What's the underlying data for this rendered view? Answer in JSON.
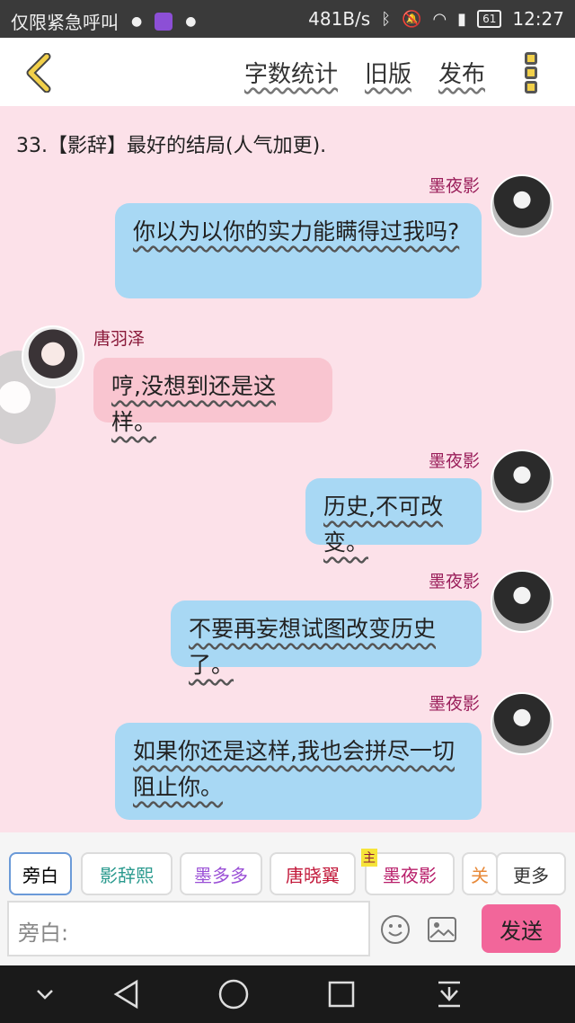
{
  "status_bar": {
    "left_text": "仅限紧急呼叫",
    "speed": "481B/s",
    "battery": "61",
    "time": "12:27"
  },
  "header": {
    "nav": [
      "字数统计",
      "旧版",
      "发布"
    ]
  },
  "chapter": {
    "title": "33.【影辞】最好的结局(人气加更)."
  },
  "messages": [
    {
      "speaker": "墨夜影",
      "text": "你以为以你的实力能瞒得过我吗?"
    },
    {
      "speaker": "唐羽泽",
      "text": "哼,没想到还是这样。"
    },
    {
      "speaker": "墨夜影",
      "text": "历史,不可改变。"
    },
    {
      "speaker": "墨夜影",
      "text": "不要再妄想试图改变历史了。"
    },
    {
      "speaker": "墨夜影",
      "text": "如果你还是这样,我也会拼尽一切阻止你。"
    }
  ],
  "roles": [
    "旁白",
    "影辞熙",
    "墨多多",
    "唐晓翼",
    "墨夜影",
    "关",
    "更多"
  ],
  "input": {
    "placeholder": "旁白:"
  },
  "send_label": "发送",
  "icons": {
    "back": "chevron-left-icon",
    "more": "more-vertical-icon",
    "emoji": "smiley-icon",
    "image": "image-icon"
  },
  "colors": {
    "chat_bg": "#fce1e9",
    "bubble_right": "#a8d8f4",
    "bubble_left": "#f9c5d0",
    "send_button": "#f2669a"
  }
}
